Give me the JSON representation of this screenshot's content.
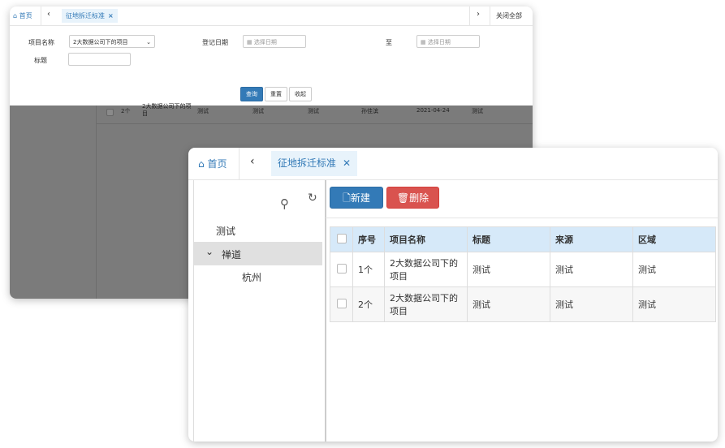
{
  "back_window": {
    "tabs": {
      "home": "首页",
      "active": "征地拆迁标准",
      "close_all": "关闭全部"
    },
    "form": {
      "project_label": "项目名称",
      "project_value": "2大数据公司下的项目",
      "reg_date_label": "登记日期",
      "date_placeholder_start": "选择日期",
      "to_label": "至",
      "date_placeholder_end": "选择日期",
      "title_label": "标题",
      "title_value": "",
      "query_btn": "查询",
      "reset_btn": "重置",
      "collapse_btn": "收起"
    },
    "bg_row": [
      "2个",
      "2大数据公司下的项目",
      "测试",
      "测试",
      "测试",
      "孙佳滨",
      "2021-04-24",
      "测试"
    ]
  },
  "front_window": {
    "tabs": {
      "home": "首页",
      "active": "征地拆迁标准"
    },
    "tree": [
      {
        "label": "测试"
      },
      {
        "label": "禅道"
      },
      {
        "label": "杭州"
      }
    ],
    "toolbar": {
      "new_btn": "新建",
      "delete_btn": "删除"
    },
    "table": {
      "headers": [
        "序号",
        "项目名称",
        "标题",
        "来源",
        "区域"
      ],
      "rows": [
        {
          "seq": "1个",
          "project": "2大数据公司下的项目",
          "title": "测试",
          "source": "测试",
          "region": "测试"
        },
        {
          "seq": "2个",
          "project": "2大数据公司下的项目",
          "title": "测试",
          "source": "测试",
          "region": "测试"
        }
      ]
    }
  },
  "colors": {
    "primary": "#337ab7",
    "danger": "#d9534f",
    "header_bg": "#d6e9f9",
    "tab_bg": "#e8f3fb"
  }
}
